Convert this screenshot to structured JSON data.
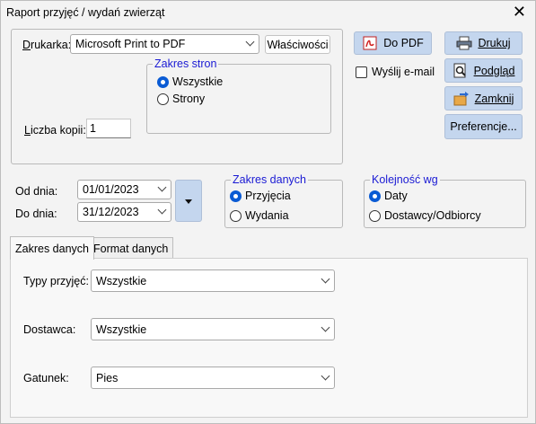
{
  "window": {
    "title": "Raport przyjęć / wydań zwierząt"
  },
  "printer": {
    "label": "Drukarka:",
    "selected": "Microsoft Print to PDF",
    "properties_button": "Właściwości",
    "copies_label": "Liczba kopii:",
    "copies_value": "1"
  },
  "page_range": {
    "title": "Zakres stron",
    "options": [
      "Wszystkie",
      "Strony"
    ],
    "selected": "Wszystkie"
  },
  "actions": {
    "pdf": "Do PDF",
    "print": "Drukuj",
    "preview": "Podgląd",
    "close": "Zamknij",
    "preferences": "Preferencje...",
    "send_email": "Wyślij e-mail"
  },
  "dates": {
    "from_label": "Od dnia:",
    "from_value": "01/01/2023",
    "to_label": "Do dnia:",
    "to_value": "31/12/2023"
  },
  "data_range": {
    "title": "Zakres danych",
    "options": [
      "Przyjęcia",
      "Wydania"
    ],
    "selected": "Przyjęcia"
  },
  "order_by": {
    "title": "Kolejność wg",
    "options": [
      "Daty",
      "Dostawcy/Odbiorcy"
    ],
    "selected": "Daty"
  },
  "tabs": [
    {
      "label": "Zakres danych",
      "active": true
    },
    {
      "label": "Format danych",
      "active": false
    }
  ],
  "filters": {
    "types": {
      "label": "Typy przyjęć:",
      "value": "Wszystkie"
    },
    "supplier": {
      "label": "Dostawca:",
      "value": "Wszystkie"
    },
    "species": {
      "label": "Gatunek:",
      "value": "Pies"
    }
  }
}
